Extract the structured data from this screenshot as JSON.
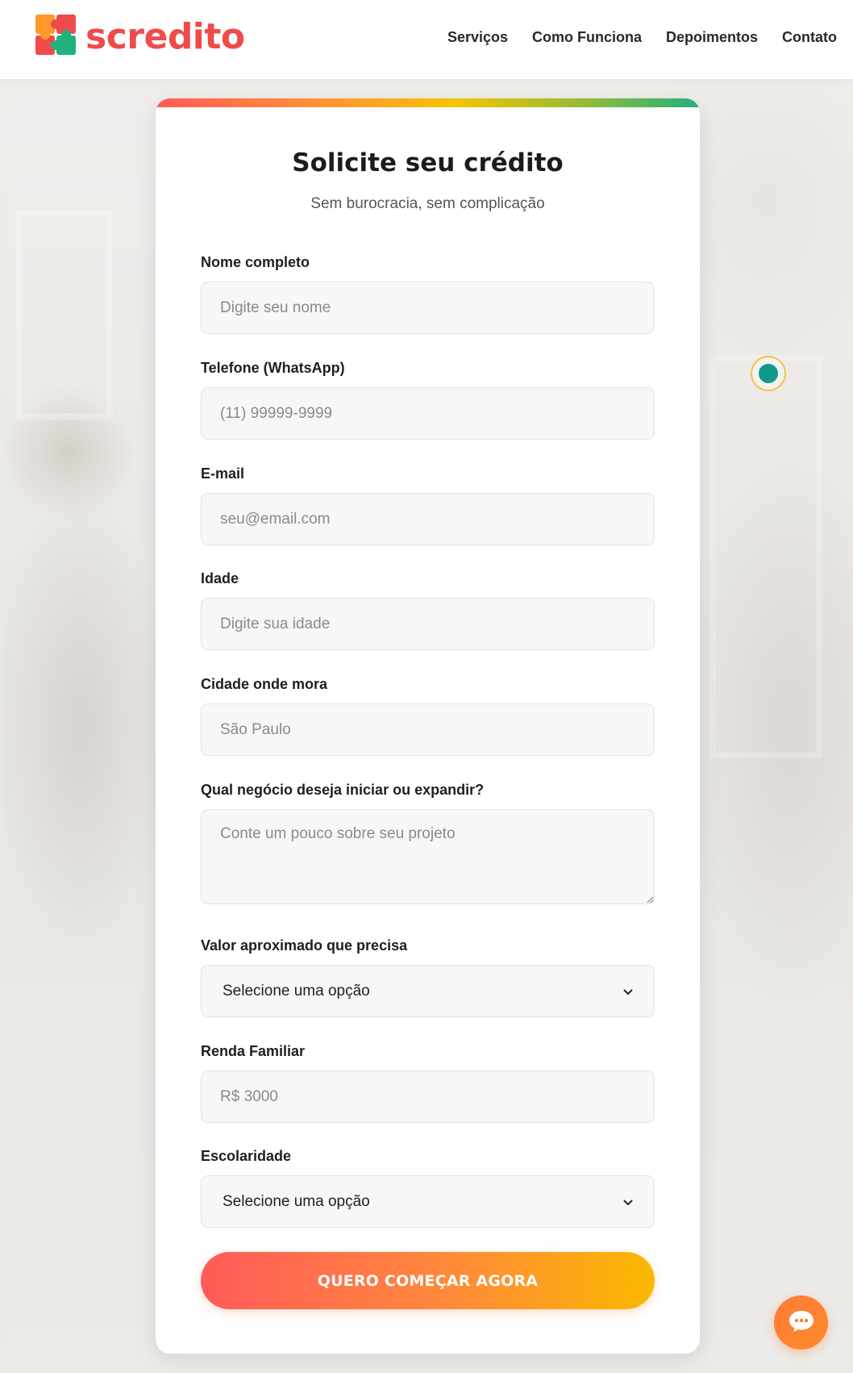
{
  "header": {
    "logo_text": "scredito",
    "nav": [
      "Serviços",
      "Como Funciona",
      "Depoimentos",
      "Contato"
    ]
  },
  "form": {
    "title": "Solicite seu crédito",
    "subtitle": "Sem burocracia, sem complicação",
    "fields": {
      "name": {
        "label": "Nome completo",
        "placeholder": "Digite seu nome"
      },
      "phone": {
        "label": "Telefone (WhatsApp)",
        "placeholder": "(11) 99999-9999"
      },
      "email": {
        "label": "E-mail",
        "placeholder": "seu@email.com"
      },
      "age": {
        "label": "Idade",
        "placeholder": "Digite sua idade"
      },
      "city": {
        "label": "Cidade onde mora",
        "placeholder": "São Paulo"
      },
      "business": {
        "label": "Qual negócio deseja iniciar ou expandir?",
        "placeholder": "Conte um pouco sobre seu projeto"
      },
      "amount": {
        "label": "Valor aproximado que precisa",
        "selected": "Selecione uma opção"
      },
      "income": {
        "label": "Renda Familiar",
        "placeholder": "R$ 3000"
      },
      "education": {
        "label": "Escolaridade",
        "selected": "Selecione uma opção"
      }
    },
    "submit_label": "QUERO COMEÇAR AGORA"
  },
  "colors": {
    "brand_red": "#f04b4b",
    "accent_orange": "#ff8a3a",
    "accent_yellow": "#fbb800",
    "teal": "#12998d"
  },
  "icons": {
    "logo": "puzzle-logo-icon",
    "dropdown": "chevron-down-icon",
    "chat": "chat-bubble-icon",
    "floating": "teal-dot-icon"
  }
}
